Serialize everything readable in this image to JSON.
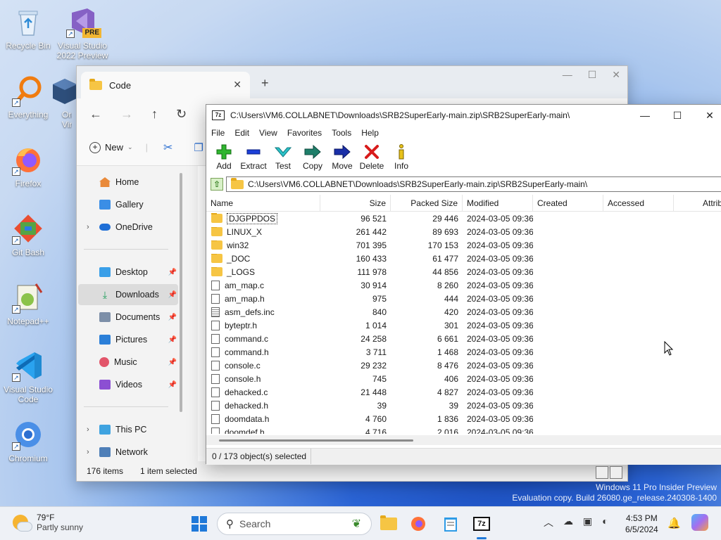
{
  "desktop": {
    "icons": [
      {
        "label": "Recycle Bin"
      },
      {
        "label": "Visual Studio 2022 Preview",
        "badge": "PRE"
      },
      {
        "label": "Everything"
      },
      {
        "label": "Ora Virt"
      },
      {
        "label": "Firefox"
      },
      {
        "label": "Git Bash"
      },
      {
        "label": "Notepad++"
      },
      {
        "label": "Visual Studio Code"
      },
      {
        "label": "Chromium"
      }
    ]
  },
  "explorer": {
    "tab_title": "Code",
    "new_button": "New",
    "sidebar": {
      "home": "Home",
      "gallery": "Gallery",
      "onedrive": "OneDrive",
      "desktop": "Desktop",
      "downloads": "Downloads",
      "documents": "Documents",
      "pictures": "Pictures",
      "music": "Music",
      "videos": "Videos",
      "thispc": "This PC",
      "network": "Network"
    },
    "status": {
      "items": "176 items",
      "selected": "1 item selected"
    }
  },
  "sevenzip": {
    "title": "C:\\Users\\VM6.COLLABNET\\Downloads\\SRB2SuperEarly-main.zip\\SRB2SuperEarly-main\\",
    "menu": [
      "File",
      "Edit",
      "View",
      "Favorites",
      "Tools",
      "Help"
    ],
    "toolbar": [
      "Add",
      "Extract",
      "Test",
      "Copy",
      "Move",
      "Delete",
      "Info"
    ],
    "address": "C:\\Users\\VM6.COLLABNET\\Downloads\\SRB2SuperEarly-main.zip\\SRB2SuperEarly-main\\",
    "columns": [
      "Name",
      "Size",
      "Packed Size",
      "Modified",
      "Created",
      "Accessed",
      "Attrib"
    ],
    "rows": [
      {
        "name": "DJGPPDOS",
        "type": "folder",
        "size": "96 521",
        "packed": "29 446",
        "modified": "2024-03-05 09:36"
      },
      {
        "name": "LINUX_X",
        "type": "folder",
        "size": "261 442",
        "packed": "89 693",
        "modified": "2024-03-05 09:36"
      },
      {
        "name": "win32",
        "type": "folder",
        "size": "701 395",
        "packed": "170 153",
        "modified": "2024-03-05 09:36"
      },
      {
        "name": "_DOC",
        "type": "folder",
        "size": "160 433",
        "packed": "61 477",
        "modified": "2024-03-05 09:36"
      },
      {
        "name": "_LOGS",
        "type": "folder",
        "size": "111 978",
        "packed": "44 856",
        "modified": "2024-03-05 09:36"
      },
      {
        "name": "am_map.c",
        "type": "file",
        "size": "30 914",
        "packed": "8 260",
        "modified": "2024-03-05 09:36"
      },
      {
        "name": "am_map.h",
        "type": "file",
        "size": "975",
        "packed": "444",
        "modified": "2024-03-05 09:36"
      },
      {
        "name": "asm_defs.inc",
        "type": "inc",
        "size": "840",
        "packed": "420",
        "modified": "2024-03-05 09:36"
      },
      {
        "name": "byteptr.h",
        "type": "file",
        "size": "1 014",
        "packed": "301",
        "modified": "2024-03-05 09:36"
      },
      {
        "name": "command.c",
        "type": "file",
        "size": "24 258",
        "packed": "6 661",
        "modified": "2024-03-05 09:36"
      },
      {
        "name": "command.h",
        "type": "file",
        "size": "3 711",
        "packed": "1 468",
        "modified": "2024-03-05 09:36"
      },
      {
        "name": "console.c",
        "type": "file",
        "size": "29 232",
        "packed": "8 476",
        "modified": "2024-03-05 09:36"
      },
      {
        "name": "console.h",
        "type": "file",
        "size": "745",
        "packed": "406",
        "modified": "2024-03-05 09:36"
      },
      {
        "name": "dehacked.c",
        "type": "file",
        "size": "21 448",
        "packed": "4 827",
        "modified": "2024-03-05 09:36"
      },
      {
        "name": "dehacked.h",
        "type": "file",
        "size": "39",
        "packed": "39",
        "modified": "2024-03-05 09:36"
      },
      {
        "name": "doomdata.h",
        "type": "file",
        "size": "4 760",
        "packed": "1 836",
        "modified": "2024-03-05 09:36"
      },
      {
        "name": "doomdef.h",
        "type": "file",
        "size": "4 716",
        "packed": "2 016",
        "modified": "2024-03-05 09:36"
      }
    ],
    "status": "0 / 173 object(s) selected"
  },
  "watermark": {
    "line1": "Windows 11 Pro Insider Preview",
    "line2": "Evaluation copy. Build 26080.ge_release.240308-1400"
  },
  "taskbar": {
    "weather_temp": "79°F",
    "weather_cond": "Partly sunny",
    "search_placeholder": "Search",
    "time": "4:53 PM",
    "date": "6/5/2024"
  }
}
